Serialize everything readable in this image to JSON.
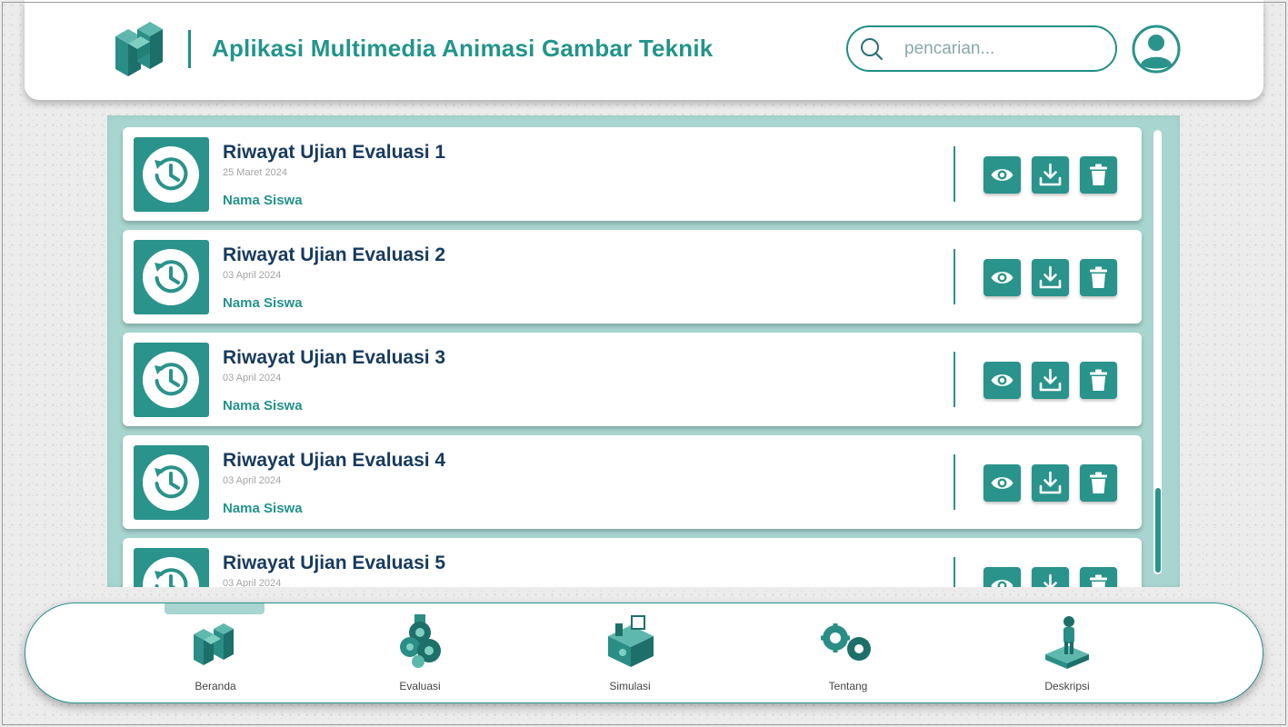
{
  "header": {
    "title": "Aplikasi Multimedia Animasi Gambar Teknik",
    "logo_icon": "isometric-blocks-logo",
    "search": {
      "placeholder": "pencarian...",
      "value": "",
      "icon": "search-icon"
    },
    "avatar_icon": "user-avatar-icon"
  },
  "colors": {
    "primary": "#2a938b",
    "title_text": "#23948b",
    "card_title": "#173a5e",
    "panel_bg": "#a8d5cf",
    "date_text": "#a3a3a3"
  },
  "records": [
    {
      "title": "Riwayat Ujian Evaluasi 1",
      "date": "25 Maret 2024",
      "student": "Nama Siswa"
    },
    {
      "title": "Riwayat Ujian Evaluasi 2",
      "date": "03 April 2024",
      "student": "Nama Siswa"
    },
    {
      "title": "Riwayat Ujian Evaluasi 3",
      "date": "03 April 2024",
      "student": "Nama Siswa"
    },
    {
      "title": "Riwayat Ujian Evaluasi 4",
      "date": "03 April 2024",
      "student": "Nama Siswa"
    },
    {
      "title": "Riwayat Ujian Evaluasi 5",
      "date": "03 April 2024",
      "student": ""
    }
  ],
  "record_actions": [
    "eye-icon",
    "download-icon",
    "trash-icon"
  ],
  "record_icon": "history-clock-icon",
  "nav": {
    "active_index": 0,
    "items": [
      {
        "label": "Beranda",
        "icon": "isometric-blocks-icon"
      },
      {
        "label": "Evaluasi",
        "icon": "gears-machine-icon"
      },
      {
        "label": "Simulasi",
        "icon": "workstation-machine-icon"
      },
      {
        "label": "Tentang",
        "icon": "cogs-icon"
      },
      {
        "label": "Deskripsi",
        "icon": "person-desk-icon"
      }
    ]
  }
}
